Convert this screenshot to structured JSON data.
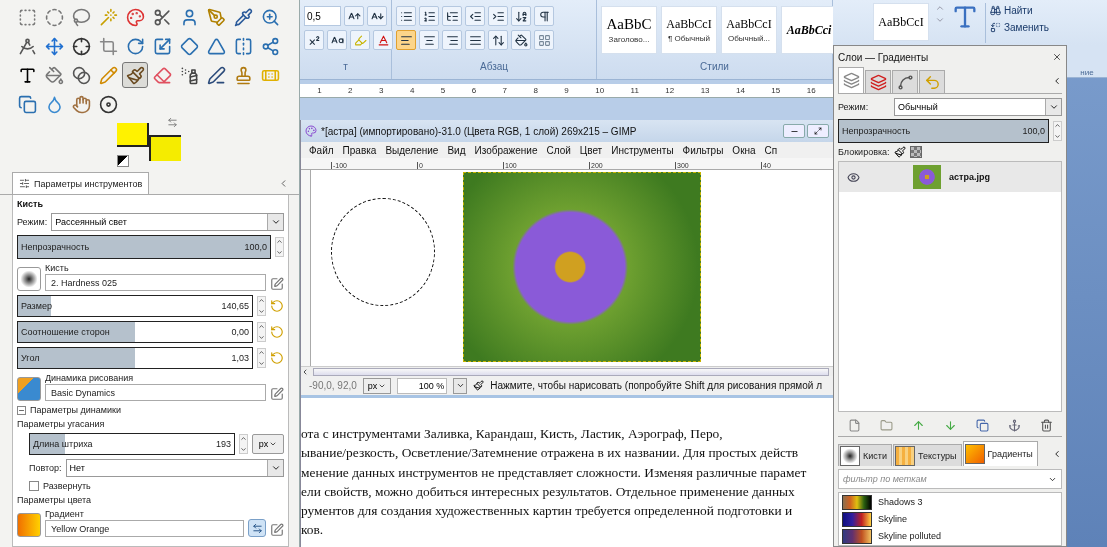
{
  "toolbox": {
    "tools": [
      {
        "kind": "rect-select",
        "selected": false
      },
      {
        "kind": "ellipse-select",
        "selected": false
      },
      {
        "kind": "lasso",
        "selected": false
      },
      {
        "kind": "wand",
        "selected": false
      },
      {
        "kind": "color-select",
        "selected": false
      },
      {
        "kind": "scissors",
        "selected": false
      },
      {
        "kind": "foreground-select",
        "selected": false
      },
      {
        "kind": "paths",
        "selected": false
      },
      {
        "kind": "picker",
        "selected": false
      },
      {
        "kind": "zoom",
        "selected": false
      },
      {
        "kind": "measure",
        "selected": false
      },
      {
        "kind": "move",
        "selected": false
      },
      {
        "kind": "align",
        "selected": false
      },
      {
        "kind": "crop",
        "selected": false
      },
      {
        "kind": "rotate",
        "selected": false
      },
      {
        "kind": "scale",
        "selected": false
      },
      {
        "kind": "shear",
        "selected": false
      },
      {
        "kind": "perspective",
        "selected": false
      },
      {
        "kind": "flip",
        "selected": false
      },
      {
        "kind": "cage",
        "selected": false
      },
      {
        "kind": "text",
        "selected": false
      },
      {
        "kind": "bucket",
        "selected": false
      },
      {
        "kind": "gradient",
        "selected": false
      },
      {
        "kind": "pencil",
        "selected": false
      },
      {
        "kind": "brush",
        "selected": true
      },
      {
        "kind": "eraser",
        "selected": false
      },
      {
        "kind": "airbrush",
        "selected": false
      },
      {
        "kind": "ink",
        "selected": false
      },
      {
        "kind": "clone",
        "selected": false
      },
      {
        "kind": "heal",
        "selected": false
      },
      {
        "kind": "perspective-clone",
        "selected": false
      },
      {
        "kind": "blur",
        "selected": false
      },
      {
        "kind": "smudge",
        "selected": false
      },
      {
        "kind": "dodge",
        "selected": false
      }
    ],
    "colors": [
      {
        "kind": "foreground",
        "color": "#fff200"
      },
      {
        "kind": "background",
        "color": "#f5ec00"
      }
    ]
  },
  "tool_options": {
    "tab": {
      "label": "Параметры инструментов",
      "selected": true
    },
    "title": "Кисть",
    "rows": [
      {
        "kind": "dropdown",
        "label": "Режим:",
        "value": "Рассеянный свет"
      },
      {
        "kind": "slider",
        "label": "Непрозрачность",
        "value": "100,0",
        "level": 1
      },
      {
        "kind": "brush",
        "label": "Кисть",
        "value": "2. Hardness 025"
      },
      {
        "kind": "reset-slider",
        "label": "Размер",
        "value": "140,65",
        "level": 0.14
      },
      {
        "kind": "reset-slider",
        "label": "Соотношение сторон",
        "value": "0,00",
        "level": 0.5
      },
      {
        "kind": "reset-slider",
        "label": "Угол",
        "value": "1,03",
        "level": 0.5
      },
      {
        "kind": "dynamics",
        "label": "Динамика рисования",
        "value": "Basic Dynamics"
      },
      {
        "kind": "expander",
        "label": "Параметры динамики",
        "expanded": true,
        "children": [
          {
            "kind": "heading",
            "label": "Параметры угасания"
          },
          {
            "kind": "unit-slider",
            "label": "Длина штриха",
            "value": "193",
            "level": 0.17,
            "unit": "px"
          },
          {
            "kind": "dropdown",
            "label": "Повтор:",
            "value": "Нет"
          },
          {
            "kind": "checkbox",
            "label": "Развернуть",
            "checked": false
          }
        ]
      },
      {
        "kind": "heading",
        "label": "Параметры цвета"
      },
      {
        "kind": "gradient",
        "label": "Градиент",
        "value": "Yellow Orange"
      }
    ]
  },
  "ribbon": {
    "font_size": "0,5",
    "align": [
      {
        "kind": "left",
        "selected": true
      },
      {
        "kind": "center",
        "selected": false
      },
      {
        "kind": "right",
        "selected": false
      },
      {
        "kind": "justify",
        "selected": false
      }
    ],
    "groups": [
      "т",
      "Абзац",
      "Стили"
    ],
    "styles": [
      {
        "sample": "AaBbC",
        "label": "Заголово...",
        "kind": "heading"
      },
      {
        "sample": "AaBbCcI",
        "label": "¶ Обычный",
        "kind": "normal"
      },
      {
        "sample": "AaBbCcI",
        "label": "Обычный...",
        "kind": "normal"
      },
      {
        "sample": "AaBbCci",
        "kind": "emphasis"
      },
      {
        "sample": "AaBbCcI",
        "kind": "normal"
      }
    ],
    "find": "Найти",
    "replace": "Заменить",
    "edit_group": "ние",
    "ruler": [
      "1",
      "2",
      "3",
      "4",
      "5",
      "6",
      "7",
      "8",
      "9",
      "10",
      "11",
      "12",
      "13",
      "14",
      "15",
      "16"
    ]
  },
  "image_window": {
    "title": "*[астра] (импортировано)-31.0 (Цвета RGB, 1 слой) 269x215 – GIMP",
    "menu": [
      "Файл",
      "Правка",
      "Выделение",
      "Вид",
      "Изображение",
      "Слой",
      "Цвет",
      "Инструменты",
      "Фильтры",
      "Окна",
      "Сп"
    ],
    "ruler": [
      "-100",
      "0",
      "100",
      "200",
      "300",
      "40"
    ],
    "status": {
      "coords": "-90,0, 92,0",
      "unit": "px",
      "zoom": "100 %",
      "message": "Нажмите, чтобы нарисовать (попробуйте Shift для рисования прямой л"
    }
  },
  "document": {
    "lines": [
      "ота с инструментами Заливка, Карандаш, Кисть, Ластик, Аэрограф, Перо,",
      "ывание/резкость, Осветление/Затемнение отражена в их названии. Для простых действ",
      "менение данных инструментов не представляет сложности. Изменяя различные парамет",
      "ели свойств, можно добиться интересных результатов. Отдельное применение данных",
      "рументов для создания художественных картин требуется определенной подготовки и",
      "ков."
    ]
  },
  "layers_dock": {
    "title": "Слои — Градиенты",
    "tabs": [
      {
        "kind": "layers",
        "selected": true
      },
      {
        "kind": "channels",
        "selected": false
      },
      {
        "kind": "paths",
        "selected": false
      },
      {
        "kind": "undo",
        "selected": false
      }
    ],
    "mode": {
      "label": "Режим:",
      "value": "Обычный"
    },
    "opacity": {
      "label": "Непрозрачность",
      "value": "100,0",
      "level": 1
    },
    "lock_label": "Блокировка:",
    "layers": [
      {
        "name": "астра.jpg",
        "visible": true,
        "selected": true
      }
    ],
    "resource_tabs": [
      {
        "kind": "brushes",
        "label": "Кисти",
        "selected": false
      },
      {
        "kind": "patterns",
        "label": "Текстуры",
        "selected": false
      },
      {
        "kind": "gradients",
        "label": "Градиенты",
        "selected": true
      }
    ],
    "filter_placeholder": "фильтр по меткам",
    "gradients": [
      {
        "name": "Shadows 3"
      },
      {
        "name": "Skyline"
      },
      {
        "name": "Skyline polluted"
      }
    ]
  }
}
